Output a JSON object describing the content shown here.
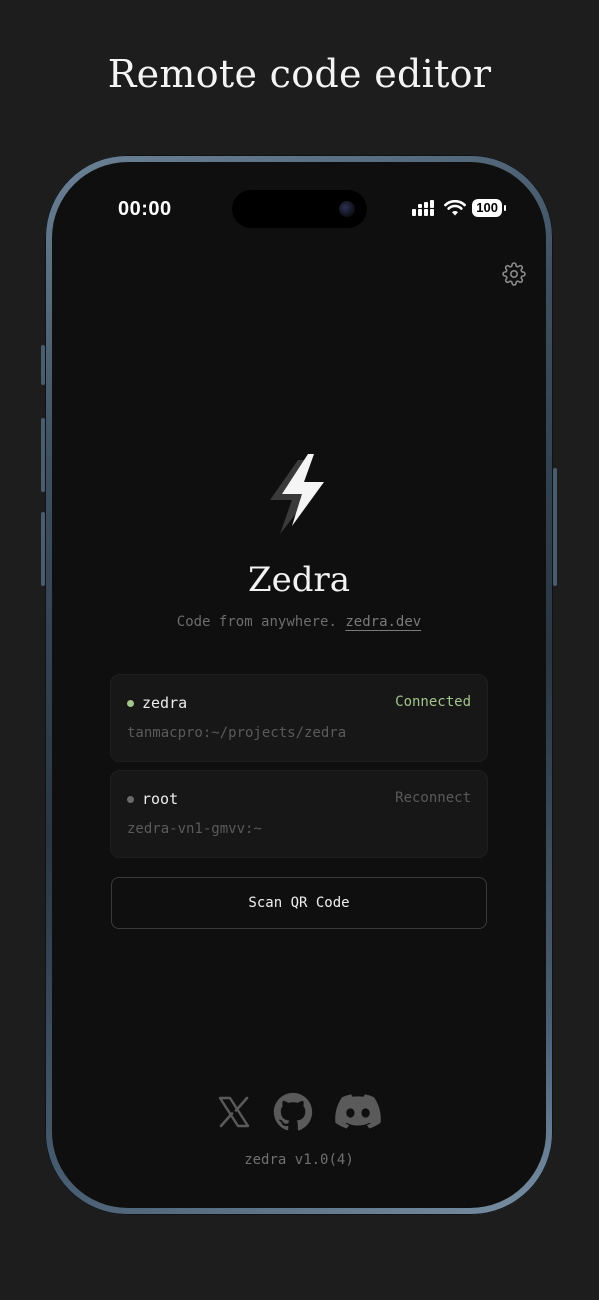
{
  "headline": "Remote code editor",
  "status_bar": {
    "time": "00:00",
    "battery": "100",
    "icons": [
      "signal-icon",
      "wifi-icon",
      "battery-icon"
    ]
  },
  "app": {
    "title": "Zedra",
    "tagline": "Code from anywhere.",
    "tagline_link": "zedra.dev"
  },
  "connections": [
    {
      "name": "zedra",
      "path": "tanmacpro:~/projects/zedra",
      "status": "Connected",
      "status_color": "#a3c48a",
      "dot_color": "#a3c48a"
    },
    {
      "name": "root",
      "path": "zedra-vn1-gmvv:~",
      "status": "Reconnect",
      "status_color": "#5a5a5a",
      "dot_color": "#6a6a6a"
    }
  ],
  "scan_button": "Scan QR Code",
  "socials": [
    "x-icon",
    "github-icon",
    "discord-icon"
  ],
  "version": "zedra v1.0(4)",
  "colors": {
    "background": "#1d1d1d",
    "screen": "#0f0f0f",
    "accent_connected": "#a3c48a"
  }
}
